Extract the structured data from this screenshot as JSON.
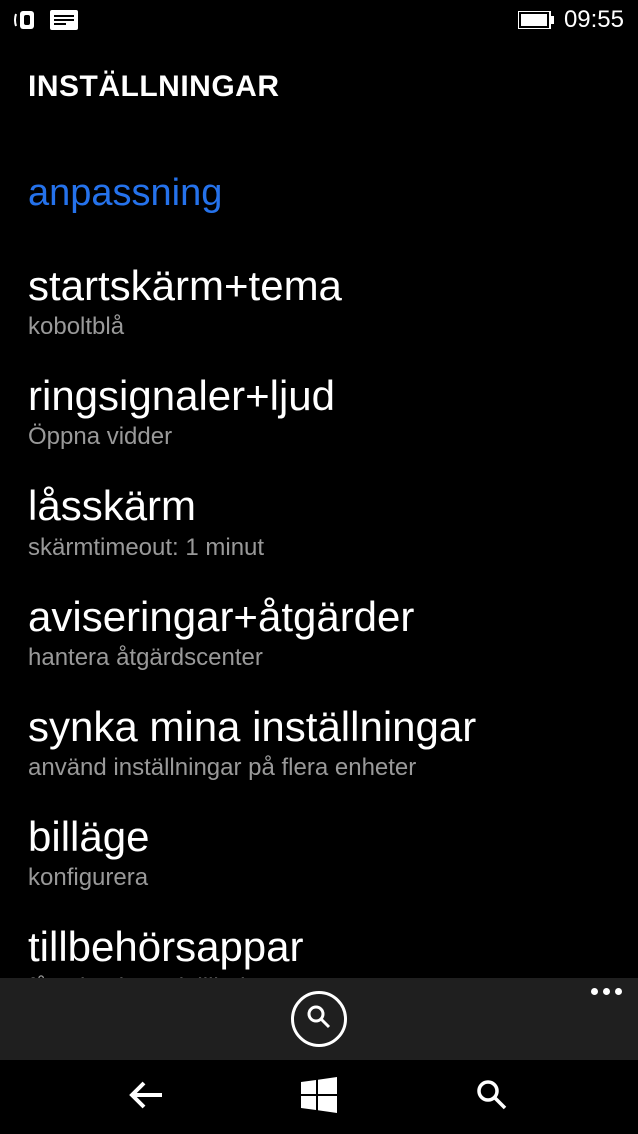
{
  "status": {
    "time": "09:55"
  },
  "header": {
    "title": "INSTÄLLNINGAR"
  },
  "section": {
    "label": "anpassning"
  },
  "items": [
    {
      "title": "startskärm+tema",
      "sub": "koboltblå"
    },
    {
      "title": "ringsignaler+ljud",
      "sub": "Öppna vidder"
    },
    {
      "title": "låsskärm",
      "sub": "skärmtimeout: 1 minut"
    },
    {
      "title": "aviseringar+åtgärder",
      "sub": "hantera åtgärdscenter"
    },
    {
      "title": "synka mina inställningar",
      "sub": "använd inställningar på flera enheter"
    },
    {
      "title": "billäge",
      "sub": "konfigurera"
    },
    {
      "title": "tillbehörsappar",
      "sub": "få aviseringar i tillbehör"
    }
  ]
}
